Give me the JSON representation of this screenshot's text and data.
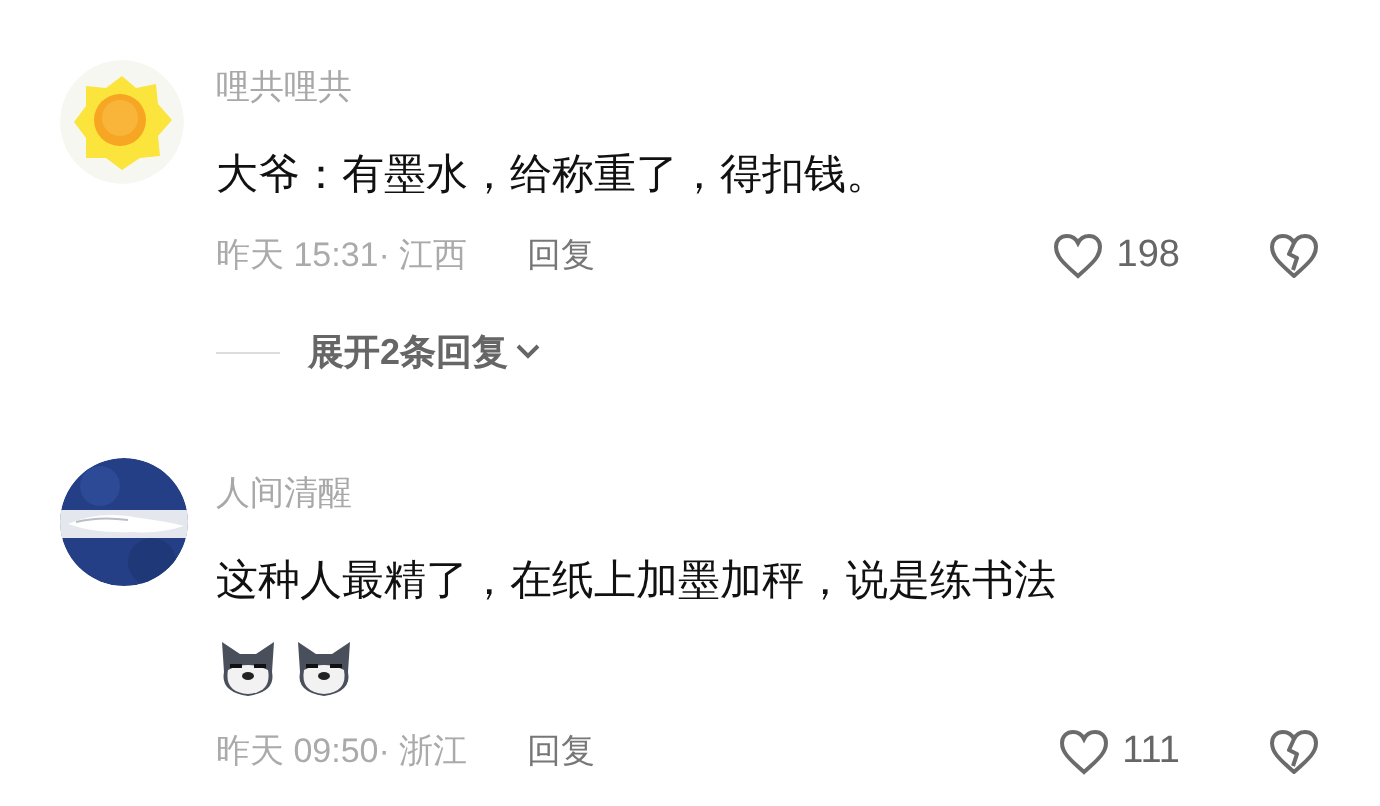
{
  "comments": [
    {
      "user": "哩共哩共",
      "text": "大爷：有墨水，给称重了，得扣钱。",
      "meta": "昨天 15:31· 江西",
      "reply": "回复",
      "likes": "198",
      "replies_toggle": "展开2条回复"
    },
    {
      "user": "人间清醒",
      "text": "这种人最精了，在纸上加墨加秤，说是练书法",
      "emojis": [
        {
          "kind": "husky"
        },
        {
          "kind": "husky"
        }
      ],
      "meta": "昨天 09:50· 浙江",
      "reply": "回复",
      "likes": "111"
    }
  ]
}
